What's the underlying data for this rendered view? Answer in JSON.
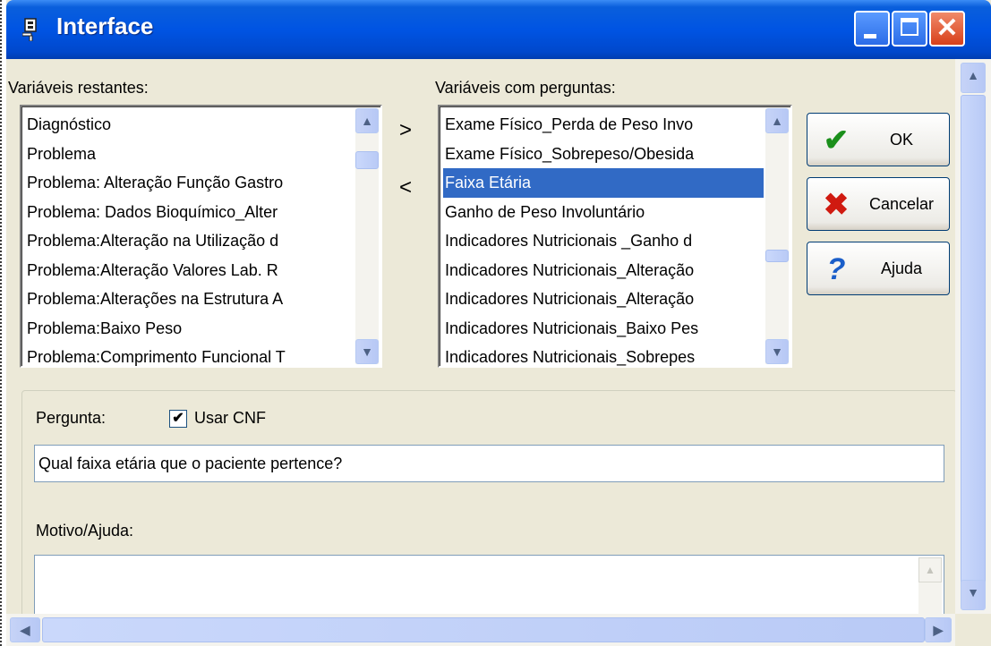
{
  "window": {
    "title": "Interface"
  },
  "left_list": {
    "label": "Variáveis restantes:",
    "items": [
      "Diagnóstico",
      "Problema",
      "Problema: Alteração Função Gastro",
      "Problema: Dados Bioquímico_Alter",
      "Problema:Alteração na Utilização d",
      "Problema:Alteração Valores Lab. R",
      "Problema:Alterações na Estrutura A",
      "Problema:Baixo Peso",
      "Problema:Comprimento Funcional T"
    ]
  },
  "right_list": {
    "label": "Variáveis com perguntas:",
    "items": [
      "Exame Físico_Perda de Peso Invo",
      "Exame Físico_Sobrepeso/Obesida",
      "Faixa Etária",
      "Ganho de Peso Involuntário",
      "Indicadores Nutricionais _Ganho d",
      "Indicadores Nutricionais_Alteração",
      "Indicadores Nutricionais_Alteração",
      "Indicadores Nutricionais_Baixo Pes",
      "Indicadores Nutricionais_Sobrepes"
    ],
    "selected_index": 2
  },
  "move_buttons": {
    "add": ">",
    "remove": "<"
  },
  "buttons": {
    "ok": "OK",
    "cancel": "Cancelar",
    "help": "Ajuda"
  },
  "question": {
    "label": "Pergunta:",
    "checkbox_label": "Usar CNF",
    "checkbox_checked": true,
    "value": "Qual faixa etária que o paciente pertence?"
  },
  "reason": {
    "label": "Motivo/Ajuda:",
    "value": ""
  },
  "icons": {
    "app": "app-icon",
    "ok": "checkmark-icon",
    "cancel": "x-icon",
    "help": "question-icon"
  },
  "colors": {
    "titlebar": "#0054e3",
    "selection": "#316ac5",
    "face": "#ece9d8"
  }
}
